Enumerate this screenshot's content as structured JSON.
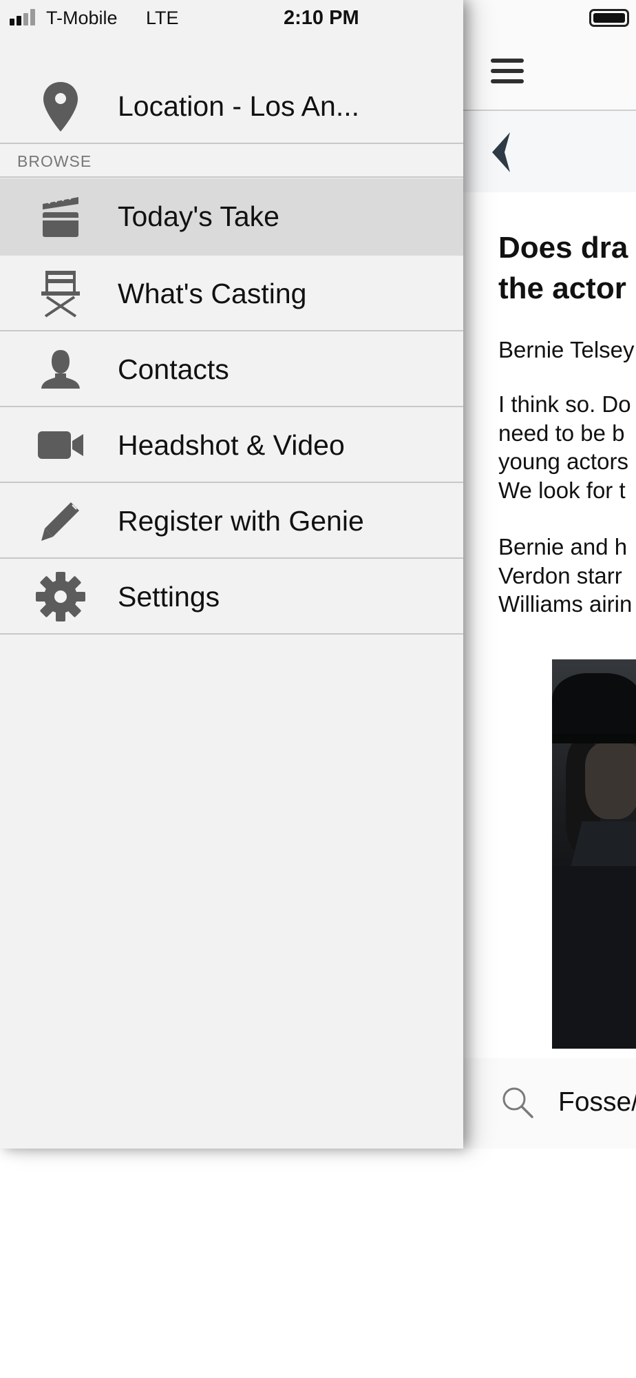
{
  "status_bar": {
    "carrier": "T-Mobile",
    "network": "LTE",
    "time": "2:10 PM"
  },
  "menu": {
    "location_label": "Location - Los An...",
    "section_header": "BROWSE",
    "items": [
      {
        "label": "Today's Take",
        "icon": "clapperboard-icon",
        "selected": true
      },
      {
        "label": "What's Casting",
        "icon": "directors-chair-icon",
        "selected": false
      },
      {
        "label": "Contacts",
        "icon": "person-silhouette-icon",
        "selected": false
      },
      {
        "label": "Headshot & Video",
        "icon": "video-camera-icon",
        "selected": false
      },
      {
        "label": "Register with Genie",
        "icon": "pencil-icon",
        "selected": false
      },
      {
        "label": "Settings",
        "icon": "gear-icon",
        "selected": false
      }
    ]
  },
  "article": {
    "title_line1": "Does dra",
    "title_line2": "the actor",
    "byline": "Bernie Telsey",
    "para1_line1": "I think so. Do",
    "para1_line2": "need to be b",
    "para1_line3": "young actors",
    "para1_line4": "We look for t",
    "para2_line1": "Bernie and h",
    "para2_line2": "Verdon starr",
    "para2_line3": "Williams airin",
    "search_text": "Fosse/"
  },
  "colors": {
    "drawer_bg": "#f2f2f2",
    "selected_bg": "#dadada",
    "icon_gray": "#5c5c5c",
    "back_chevron": "#2e3a46"
  }
}
